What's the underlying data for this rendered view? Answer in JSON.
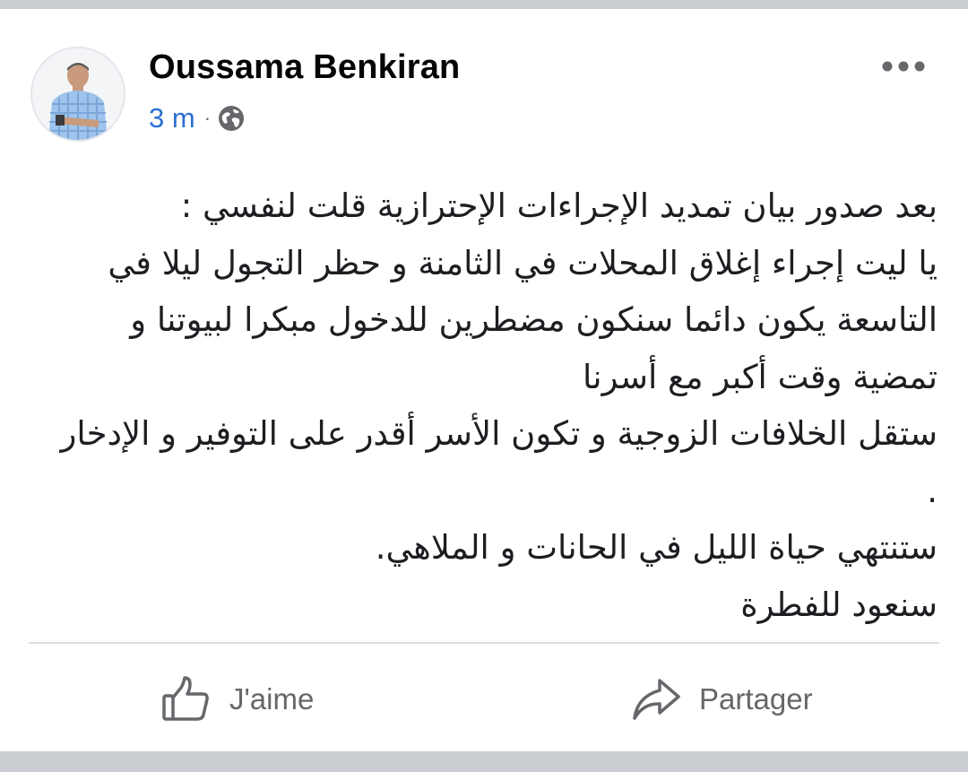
{
  "post": {
    "author": "Oussama Benkiran",
    "time": "3 m",
    "separator": "·",
    "privacy_icon": "globe-icon",
    "more_icon": "more-horizontal-icon",
    "lines": [
      "بعد صدور بيان تمديد الإجراءات الإحترازية قلت لنفسي :",
      "يا ليت إجراء إغلاق المحلات في الثامنة و حظر التجول ليلا في التاسعة يكون دائما سنكون مضطرين للدخول مبكرا لبيوتنا و تمضية وقت أكبر مع أسرنا",
      "ستقل الخلافات الزوجية و تكون الأسر أقدر على التوفير و الإدخار .",
      "ستنتهي حياة الليل في الحانات و الملاهي.",
      "سنعود للفطرة"
    ]
  },
  "actions": {
    "like_label": "J'aime",
    "like_icon": "thumbs-up-icon",
    "share_label": "Partager",
    "share_icon": "share-arrow-icon"
  },
  "colors": {
    "link_blue": "#2d6fd2",
    "muted_gray": "#65676b",
    "background_gray": "#c9ccd1"
  }
}
